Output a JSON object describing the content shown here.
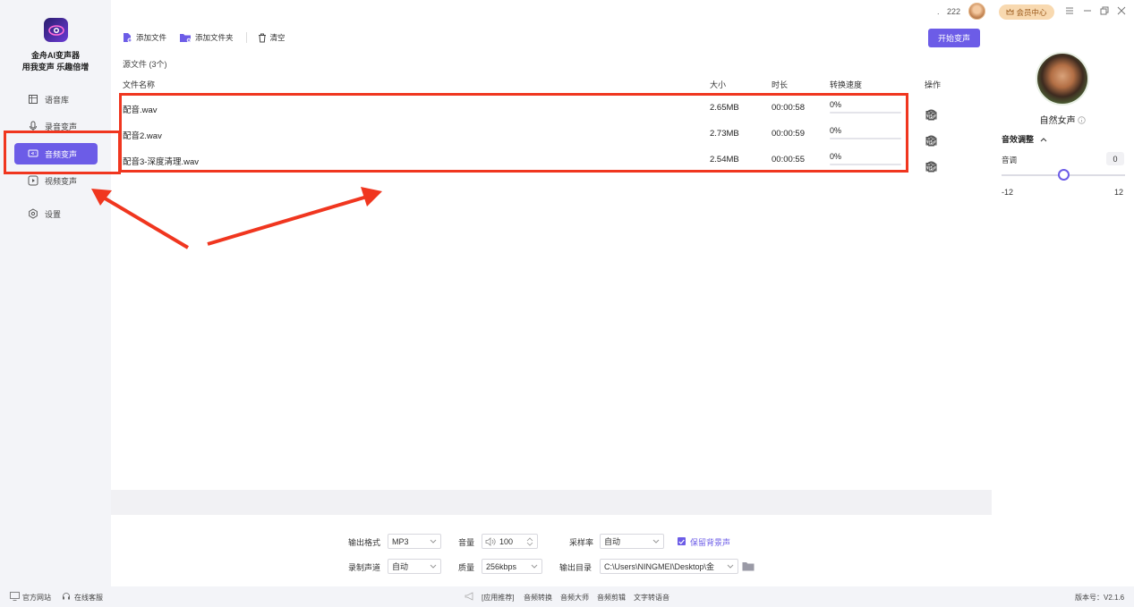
{
  "app": {
    "name": "金舟AI变声器",
    "slogan": "用我变声 乐趣倍增"
  },
  "sidebar": {
    "items": [
      {
        "label": "语音库",
        "icon": "cube-icon",
        "active": false
      },
      {
        "label": "录音变声",
        "icon": "mic-icon",
        "active": false
      },
      {
        "label": "音频变声",
        "icon": "audio-icon",
        "active": true
      },
      {
        "label": "视频变声",
        "icon": "video-icon",
        "active": false
      },
      {
        "label": "设置",
        "icon": "gear-icon",
        "active": false
      }
    ]
  },
  "toolbar": {
    "add_file": "添加文件",
    "add_folder": "添加文件夹",
    "clear": "清空",
    "start": "开始变声"
  },
  "file_list": {
    "source_count": "源文件 (3个)",
    "headers": {
      "name": "文件名称",
      "size": "大小",
      "duration": "时长",
      "speed": "转换速度",
      "ops": "操作"
    },
    "rows": [
      {
        "name": "配音.wav",
        "size": "2.65MB",
        "duration": "00:00:58",
        "progress_text": "0%",
        "progress": 0
      },
      {
        "name": "配音2.wav",
        "size": "2.73MB",
        "duration": "00:00:59",
        "progress_text": "0%",
        "progress": 0
      },
      {
        "name": "配音3-深度清理.wav",
        "size": "2.54MB",
        "duration": "00:00:55",
        "progress_text": "0%",
        "progress": 0
      }
    ]
  },
  "settings": {
    "format_label": "输出格式",
    "format_value": "MP3",
    "volume_label": "音量",
    "volume_value": "100",
    "samplerate_label": "采样率",
    "samplerate_value": "自动",
    "keep_bg_label": "保留背景声",
    "keep_bg_checked": true,
    "channel_label": "录制声道",
    "channel_value": "自动",
    "quality_label": "质量",
    "quality_value": "256kbps",
    "outdir_label": "输出目录",
    "outdir_value": "C:\\Users\\NINGMEI\\Desktop\\金"
  },
  "topbar": {
    "points": "222",
    "vip_label": "会员中心"
  },
  "voice": {
    "name": "自然女声",
    "fx_title": "音效调整",
    "pitch_label": "音调",
    "pitch_value": "0",
    "pitch_min": "-12",
    "pitch_max": "12",
    "pitch_level": 0
  },
  "footer": {
    "website": "官方网站",
    "support": "在线客服",
    "recommend": "[应用推荐]",
    "links": [
      "音频转换",
      "音频大师",
      "音频剪辑",
      "文字转语音"
    ],
    "version": "版本号：V2.1.6"
  },
  "colors": {
    "accent": "#6c5ce7",
    "annotation": "#f0361f"
  }
}
